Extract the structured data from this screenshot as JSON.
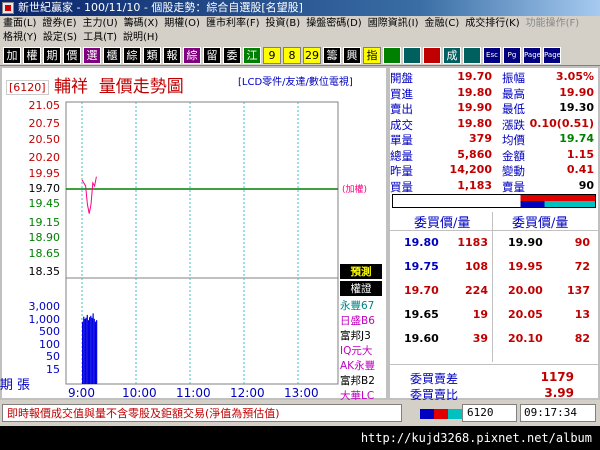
{
  "window": {
    "title": "新世紀贏家 - 100/11/10 - 個股走勢：綜合自選股[名望股]"
  },
  "menu": {
    "row1": [
      "畫面(L)",
      "證券(E)",
      "主力(U)",
      "籌碼(X)",
      "期權(O)",
      "匯市利率(F)",
      "投資(B)",
      "操盤密碼(D)",
      "國際資訊(I)",
      "金融(C)",
      "成交排行(K)",
      "功能操作(F)"
    ],
    "row2": [
      "格視(Y)",
      "設定(S)",
      "工具(T)",
      "說明(H)"
    ]
  },
  "toolbar": [
    "加",
    "權",
    "期",
    "價",
    "選",
    "櫃",
    "綜",
    "類",
    "報",
    "綜",
    "留",
    "委",
    "江",
    "9",
    "8",
    "29",
    "籌",
    "興",
    "指",
    "",
    "",
    "",
    "成",
    "",
    "Esc",
    "Pg",
    "Page",
    "Page"
  ],
  "stock": {
    "code": "[6120]",
    "name": "輔祥",
    "chart_title": "量價走勢圖",
    "sector": "[LCD零件/友達/數位電視]",
    "limit_tag": "(加權)"
  },
  "quote": [
    {
      "l1": "開盤",
      "v1": "19.70",
      "l2": "振幅",
      "v2": "3.05%",
      "c1": "#c00000",
      "c2": "#c00000"
    },
    {
      "l1": "買進",
      "v1": "19.80",
      "l2": "最高",
      "v2": "19.90",
      "c1": "#c00000",
      "c2": "#c00000"
    },
    {
      "l1": "賣出",
      "v1": "19.90",
      "l2": "最低",
      "v2": "19.30",
      "c1": "#c00000",
      "c2": "#000000"
    },
    {
      "l1": "成交",
      "v1": "19.80",
      "l2": "漲跌",
      "v2": "0.10(0.51)",
      "c1": "#c00000",
      "c2": "#c00000"
    },
    {
      "l1": "單量",
      "v1": "379",
      "l2": "均價",
      "v2": "19.74",
      "c1": "#c00000",
      "c2": "#008000"
    },
    {
      "l1": "總量",
      "v1": "5,860",
      "l2": "金額",
      "v2": "1.15",
      "c1": "#c00000",
      "c2": "#c00000"
    },
    {
      "l1": "昨量",
      "v1": "14,200",
      "l2": "變動",
      "v2": "0.41",
      "c1": "#c00000",
      "c2": "#c00000"
    },
    {
      "l1": "買量",
      "v1": "1,183",
      "l2": "賣量",
      "v2": "90",
      "c1": "#c00000",
      "c2": "#000000"
    }
  ],
  "orderbook": {
    "bid_header": "委買價/量",
    "ask_header": "委買價/量",
    "rows": [
      {
        "bp": "19.80",
        "bq": "1183",
        "ap": "19.90",
        "aq": "90",
        "bpc": "#0000c0",
        "apc": "#000000"
      },
      {
        "bp": "19.75",
        "bq": "108",
        "ap": "19.95",
        "aq": "72",
        "bpc": "#0000c0",
        "apc": "#c00000"
      },
      {
        "bp": "19.70",
        "bq": "224",
        "ap": "20.00",
        "aq": "137",
        "bpc": "#c00000",
        "apc": "#c00000"
      },
      {
        "bp": "19.65",
        "bq": "19",
        "ap": "20.05",
        "aq": "13",
        "bpc": "#000000",
        "apc": "#c00000"
      },
      {
        "bp": "19.60",
        "bq": "39",
        "ap": "20.10",
        "aq": "82",
        "bpc": "#000000",
        "apc": "#c00000"
      }
    ],
    "diff_label": "委買賣差",
    "diff_value": "1179",
    "ratio_label": "委買賣比",
    "ratio_value": "3.99"
  },
  "brokers": {
    "buttons": [
      "預測",
      "權證"
    ],
    "items": [
      {
        "name": "永豐67",
        "color": "#008080"
      },
      {
        "name": "日盛B6",
        "color": "#c000c0"
      },
      {
        "name": "富邦J3",
        "color": "#000000"
      },
      {
        "name": "IQ元大",
        "color": "#c000c0"
      },
      {
        "name": "AK永豐",
        "color": "#c000c0"
      },
      {
        "name": "富邦B2",
        "color": "#000000"
      },
      {
        "name": "大華LC",
        "color": "#c000c0"
      }
    ]
  },
  "chart_data": {
    "type": "line",
    "y_ticks": [
      "21.05",
      "20.75",
      "20.50",
      "20.20",
      "19.95",
      "19.70",
      "19.45",
      "19.15",
      "18.90",
      "18.65",
      "18.35"
    ],
    "ylim": [
      18.35,
      21.05
    ],
    "reference_price": 19.7,
    "x_ticks": [
      "9:00",
      "10:00",
      "11:00",
      "12:00",
      "13:00"
    ],
    "price_series": {
      "name": "",
      "x_minutes": [
        0,
        2,
        4,
        6,
        8,
        10,
        12,
        14,
        16
      ],
      "values": [
        19.85,
        19.8,
        19.75,
        19.45,
        19.3,
        19.45,
        19.8,
        19.75,
        19.9
      ]
    },
    "volume": {
      "y_ticks": [
        "3,000",
        "1,000",
        "500",
        "100",
        "50",
        "15"
      ],
      "bars": [
        600,
        1000,
        800,
        900,
        1200,
        700,
        950,
        1100,
        900,
        1400,
        800,
        600,
        700
      ]
    },
    "volume_axis_label": [
      "期",
      "張"
    ]
  },
  "status": {
    "message": "即時報價成交值與量不含零股及鉅額交易(淨值為預估值)",
    "code": "6120",
    "time": "09:17:34"
  },
  "watermark": "http://kujd3268.pixnet.net/album"
}
